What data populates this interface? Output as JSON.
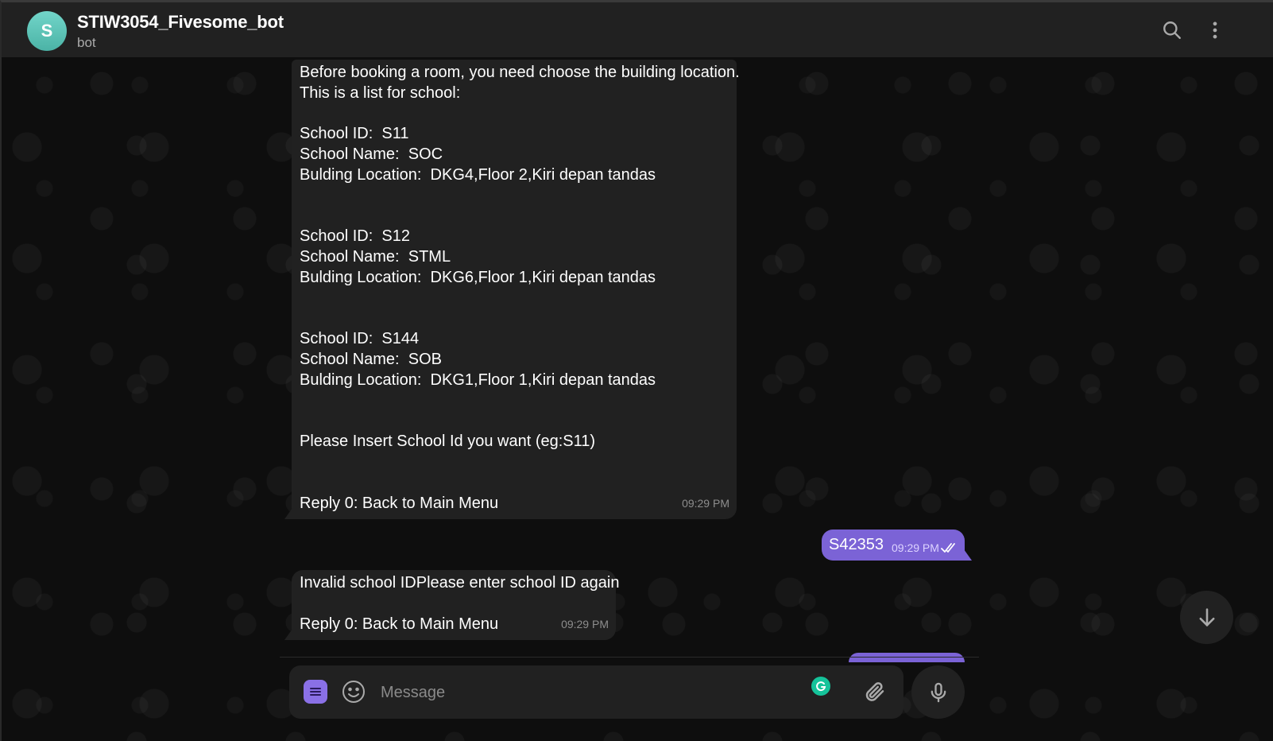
{
  "header": {
    "avatar_letter": "S",
    "title": "STIW3054_Fivesome_bot",
    "subtitle": "bot",
    "icons": [
      "search-icon",
      "more-vertical-icon"
    ]
  },
  "messages": [
    {
      "from": "bot",
      "lines": [
        "Before booking a room, you need choose the building location.",
        "This is a list for school:",
        "",
        "School ID:  S11",
        "School Name:  SOC",
        "Bulding Location:  DKG4,Floor 2,Kiri depan tandas",
        "",
        "",
        "School ID:  S12",
        "School Name:  STML",
        "Bulding Location:  DKG6,Floor 1,Kiri depan tandas",
        "",
        "",
        "School ID:  S144",
        "School Name:  SOB",
        "Bulding Location:  DKG1,Floor 1,Kiri depan tandas",
        "",
        "",
        "Please Insert School Id you want (eg:S11)",
        "",
        "",
        "Reply 0: Back to Main Menu"
      ],
      "time": "09:29 PM"
    },
    {
      "from": "user",
      "text": "S42353",
      "time": "09:29 PM",
      "status_icon": "double-check-icon"
    },
    {
      "from": "bot",
      "lines": [
        "Invalid school IDPlease enter school ID again",
        "",
        "Reply 0: Back to Main Menu"
      ],
      "time": "09:29 PM"
    }
  ],
  "composer": {
    "placeholder": "Message",
    "icons": [
      "menu-icon",
      "emoji-icon",
      "grammarly-icon",
      "attach-icon",
      "microphone-icon"
    ]
  },
  "scroll_down_icon": "arrow-down-icon",
  "colors": {
    "header_bg": "#212121",
    "bubble_in": "#212121",
    "bubble_out": "#7b63d6",
    "accent": "#8a70e6",
    "avatar": "#5ec3b6"
  }
}
